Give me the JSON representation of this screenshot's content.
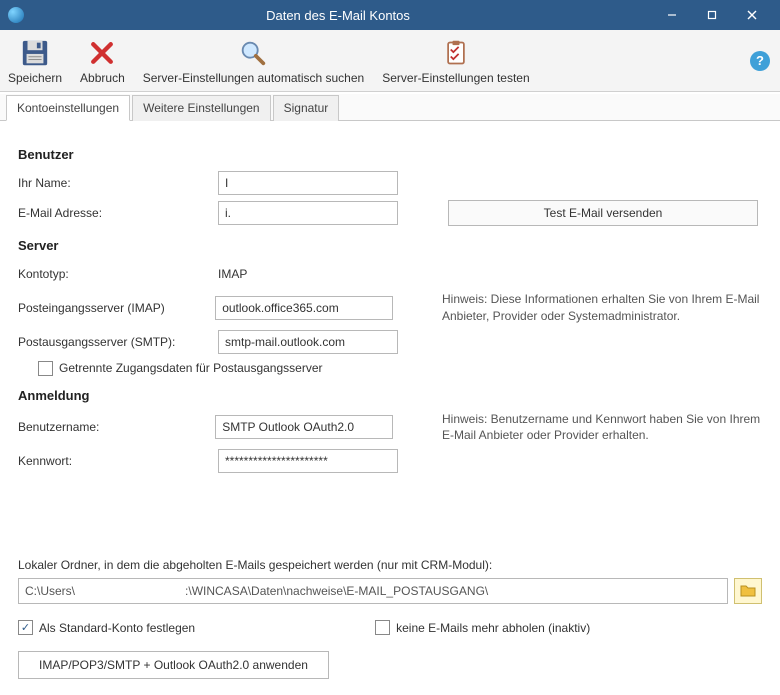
{
  "window": {
    "title": "Daten des E-Mail Kontos"
  },
  "toolbar": {
    "save": "Speichern",
    "cancel": "Abbruch",
    "auto": "Server-Einstellungen automatisch suchen",
    "test": "Server-Einstellungen testen"
  },
  "tabs": {
    "t0": "Kontoeinstellungen",
    "t1": "Weitere Einstellungen",
    "t2": "Signatur"
  },
  "user": {
    "section": "Benutzer",
    "name_label": "Ihr Name:",
    "name_value": "I",
    "email_label": "E-Mail Adresse:",
    "email_value": "i.",
    "test_btn": "Test E-Mail versenden"
  },
  "server": {
    "section": "Server",
    "type_label": "Kontotyp:",
    "type_value": "IMAP",
    "in_label": "Posteingangsserver (IMAP)",
    "in_value": "outlook.office365.com",
    "out_label": "Postausgangsserver (SMTP):",
    "out_value": "smtp-mail.outlook.com",
    "sep_creds": "Getrennte Zugangsdaten für Postausgangsserver",
    "hint": "Hinweis: Diese Informationen erhalten Sie von Ihrem E-Mail Anbieter, Provider oder Systemadministrator."
  },
  "auth": {
    "section": "Anmeldung",
    "user_label": "Benutzername:",
    "user_value": "SMTP Outlook OAuth2.0",
    "pass_label": "Kennwort:",
    "pass_value": "**********************",
    "hint": "Hinweis: Benutzername und Kennwort haben Sie von Ihrem  E-Mail Anbieter oder Provider erhalten."
  },
  "footer": {
    "path_label": "Lokaler Ordner, in dem die abgeholten E-Mails gespeichert werden (nur mit CRM-Modul):",
    "path_value": "C:\\Users\\                                 :\\WINCASA\\Daten\\nachweise\\E-MAIL_POSTAUSGANG\\",
    "default_chk": "Als Standard-Konto festlegen",
    "nofetch_chk": "keine E-Mails mehr abholen (inaktiv)",
    "apply_btn": "IMAP/POP3/SMTP + Outlook OAuth2.0 anwenden"
  }
}
